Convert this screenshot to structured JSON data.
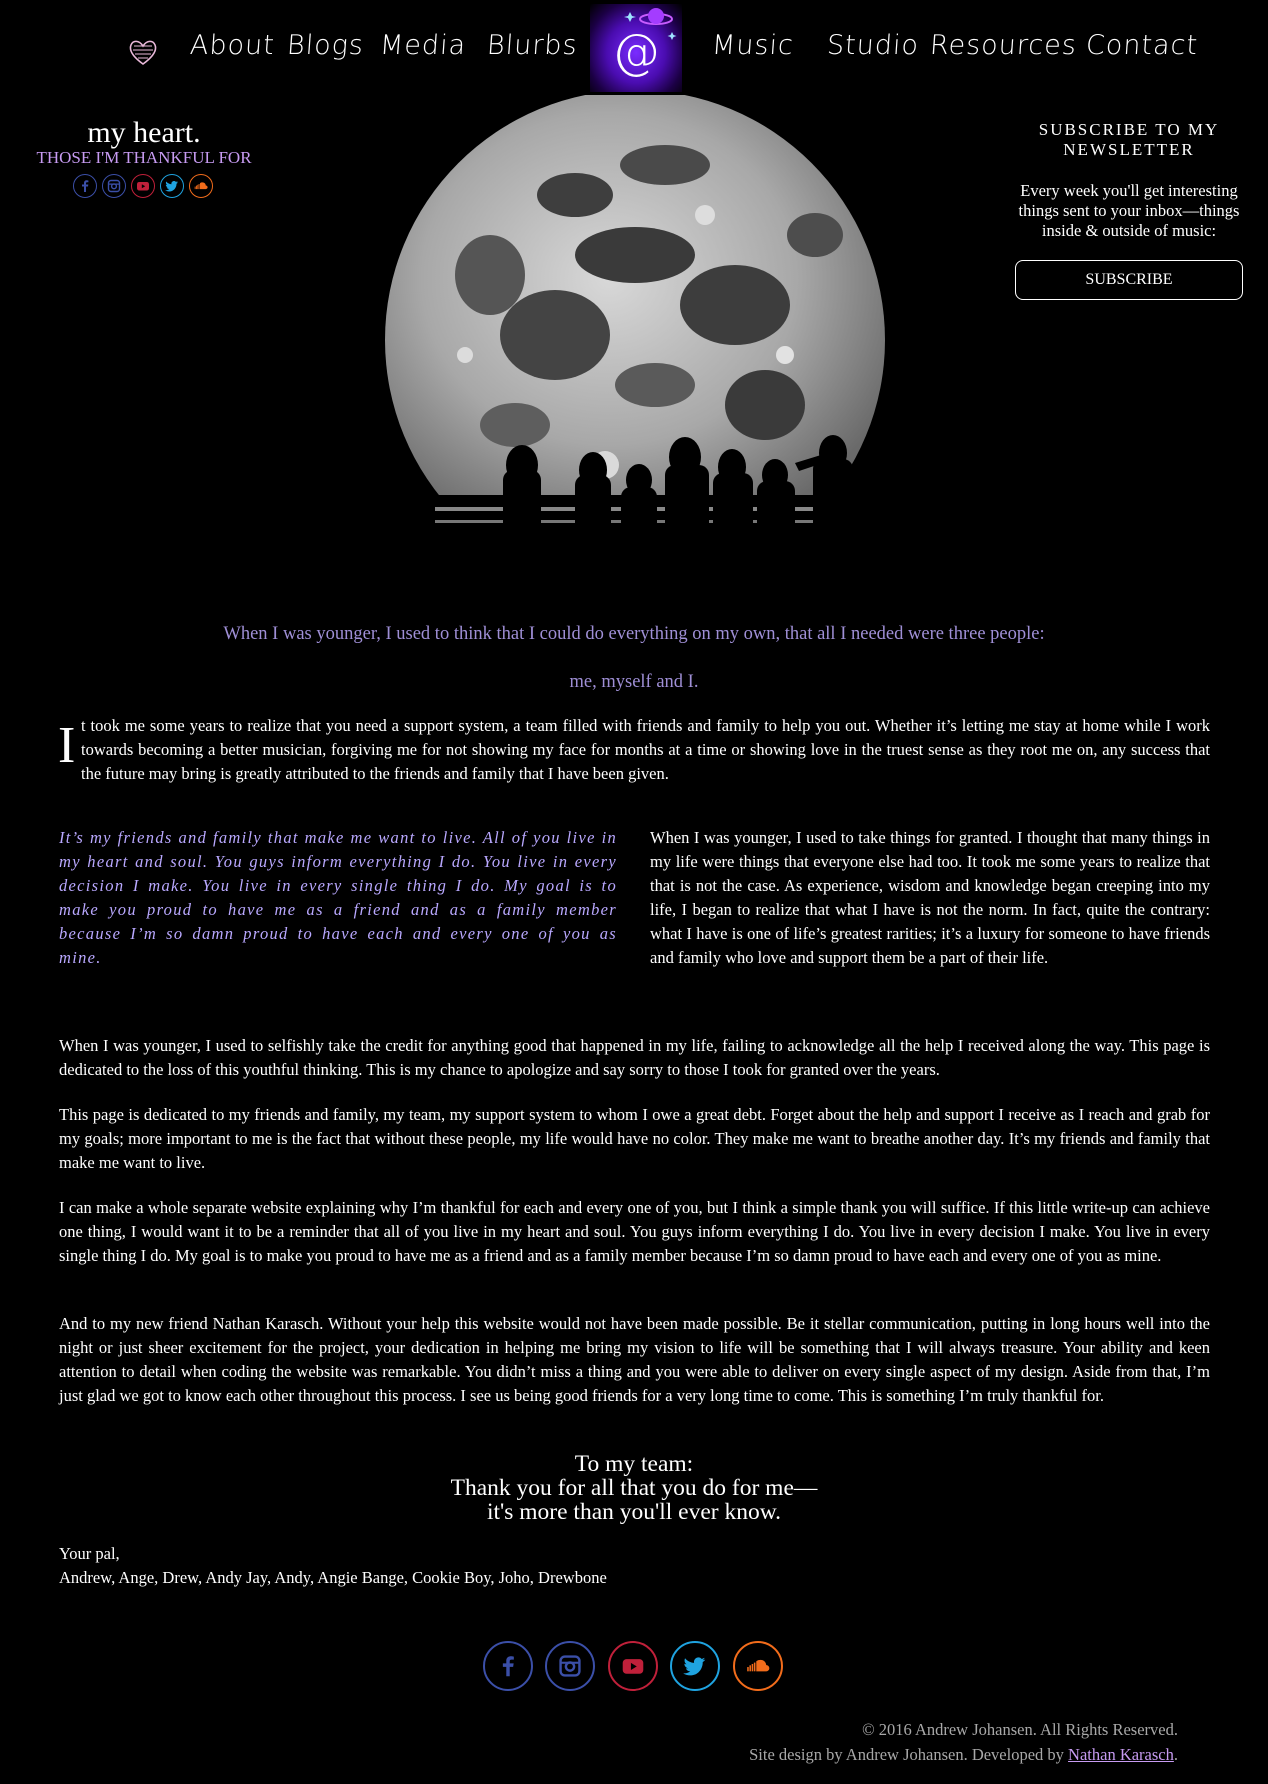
{
  "nav": {
    "left_items": [
      {
        "label": "About"
      },
      {
        "label": "Blogs"
      },
      {
        "label": "Media"
      },
      {
        "label": "Blurbs"
      }
    ],
    "right_items": [
      {
        "label": "Music"
      },
      {
        "label": "Studio"
      },
      {
        "label": "Resources"
      },
      {
        "label": "Contact"
      }
    ],
    "logo_glyph": "@"
  },
  "page": {
    "title": "my heart.",
    "subtitle": "THOSE I'M THANKFUL FOR"
  },
  "social": [
    "facebook-icon",
    "instagram-icon",
    "youtube-icon",
    "twitter-icon",
    "soundcloud-icon"
  ],
  "colors": {
    "accent": "#c79bf2",
    "lead_text": "#9f8fd6",
    "quote_text": "#b9a8ff",
    "facebook": "#3b4fa8",
    "instagram": "#3b4fa8",
    "youtube": "#c0203a",
    "twitter": "#1fa3e0",
    "soundcloud": "#f26c1b"
  },
  "newsletter": {
    "title": "SUBSCRIBE TO MY NEWSLETTER",
    "text": "Every week you'll get interesting things sent to your inbox—things inside & outside of music:",
    "button": "SUBSCRIBE"
  },
  "content": {
    "lead_1": "When I was younger, I used to think that I could do everything on my own, that all I needed were three people:",
    "lead_2": "me, myself and I.",
    "dropcap": "I",
    "intro": "t took me some years to realize that you need a support system, a team filled with friends and family to help you out. Whether it’s letting me stay at home while I work towards becoming a better musician, forgiving me for not showing my face for months at a time or showing love in the truest sense as they root me on, any success that the future may bring is greatly attributed to the friends and family that I have been given.",
    "quote": "It’s my friends and family that make me want to live. All of you live in my heart and soul. You guys inform everything I do. You live in every decision I make. You live in every single thing I do. My goal is to make you proud to have me as a friend and as a family member because I’m so damn proud to have each and every one of you as mine.",
    "col2": "When I was younger, I used to take things for granted. I thought that many things in my life were things that everyone else had too. It took me some years to realize that that is not the case. As experience, wisdom and knowledge began creeping into my life, I began to realize that what I have is not the norm. In fact, quite the contrary: what I have is one of life’s greatest rarities; it’s a luxury for someone to have friends and family who love and support them be a part of their life.",
    "p1": "When I was younger, I used to selfishly take the credit for anything good that happened in my life, failing to acknowledge all the help I received along the way. This page is dedicated to the loss of this youthful thinking. This is my chance to apologize and say sorry to those I took for granted over the years.",
    "p2": "This page is dedicated to my friends and family, my team, my support system to whom I owe a great debt. Forget about the help and support I receive as I reach and grab for my goals; more important to me is the fact that without these people, my life would have no color. They make me want to breathe another day. It’s my friends and family that make me want to live.",
    "p3": "I can make a whole separate website explaining why I’m thankful for each and every one of you, but I think a simple thank you will suffice. If this little write-up can achieve one thing, I would want it to be a reminder that all of you live in my heart and soul. You guys inform everything I do. You live in every decision I make. You live in every single thing I do. My goal is to make you proud to have me as a friend and as a family member because I’m so damn proud to have each and every one of you as mine.",
    "p4": "And to my new friend Nathan Karasch. Without your help this website would not have been made possible. Be it stellar communication, putting in long hours well into the night or just sheer excitement for the project, your dedication in helping me bring my vision to life will be something that I will always treasure. Your ability and keen attention to detail when coding the website was remarkable. You didn’t miss a thing and you were able to deliver on every single aspect of my design. Aside from that, I’m just glad we got to know each other throughout this process. I see us being good friends for a very long time to come. This is something I’m truly thankful for.",
    "thanks_1": "To my team:",
    "thanks_2": "Thank you for all that you do for me—",
    "thanks_3": "it's more than you'll ever know.",
    "sign_1": "Your pal,",
    "sign_2": "Andrew, Ange, Drew, Andy Jay, Andy, Angie Bange, Cookie Boy, Joho, Drewbone"
  },
  "footer": {
    "copyright": "© 2016 Andrew Johansen. All Rights Reserved.",
    "credit_prefix": "Site design by Andrew Johansen. Developed by ",
    "developer": "Nathan Karasch",
    "credit_suffix": "."
  }
}
